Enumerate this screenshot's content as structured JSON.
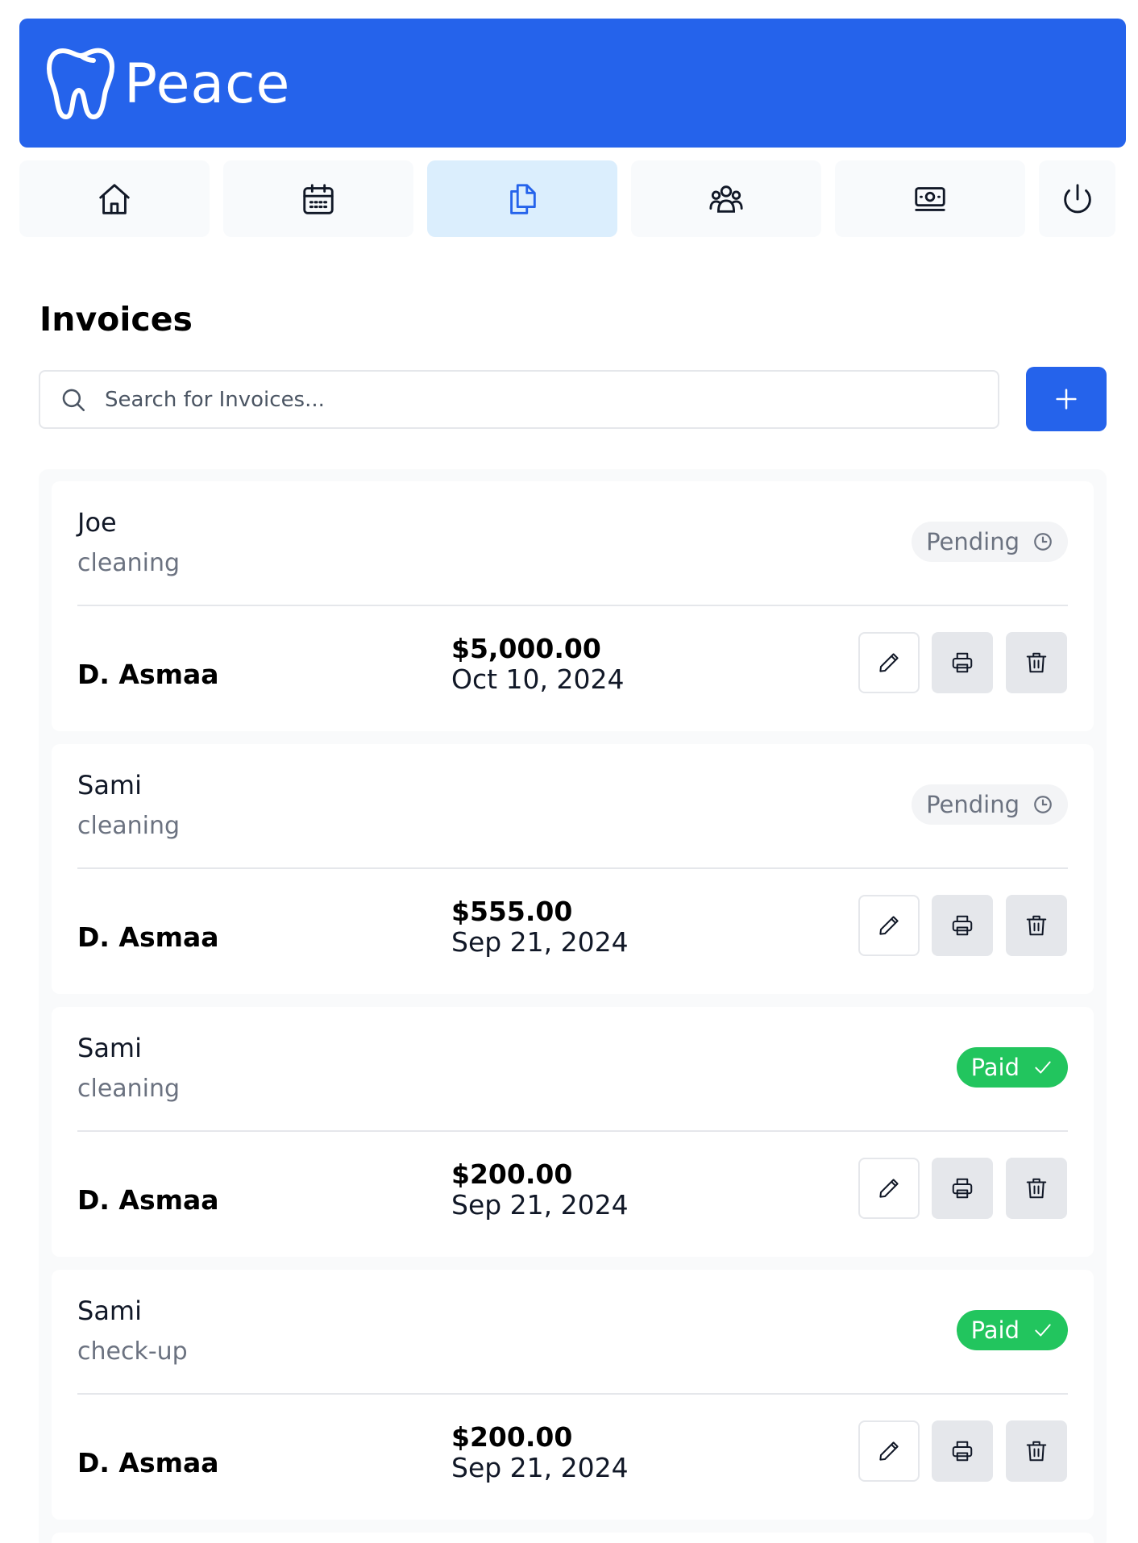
{
  "app": {
    "name": "Peace",
    "logo_icon": "tooth-icon",
    "brand_color": "#2563eb"
  },
  "nav": {
    "items": [
      {
        "icon": "home-icon"
      },
      {
        "icon": "calendar-icon"
      },
      {
        "icon": "documents-icon",
        "active": true
      },
      {
        "icon": "users-icon"
      },
      {
        "icon": "money-icon"
      },
      {
        "icon": "power-icon"
      }
    ]
  },
  "page": {
    "title": "Invoices"
  },
  "search": {
    "placeholder": "Search for Invoices..."
  },
  "invoices": [
    {
      "patient": "Joe",
      "service": "cleaning",
      "status": "Pending",
      "doctor": "D. Asmaa",
      "amount": "$5,000.00",
      "date": "Oct 10, 2024"
    },
    {
      "patient": "Sami",
      "service": "cleaning",
      "status": "Pending",
      "doctor": "D. Asmaa",
      "amount": "$555.00",
      "date": "Sep 21, 2024"
    },
    {
      "patient": "Sami",
      "service": "cleaning",
      "status": "Paid",
      "doctor": "D. Asmaa",
      "amount": "$200.00",
      "date": "Sep 21, 2024"
    },
    {
      "patient": "Sami",
      "service": "check-up",
      "status": "Paid",
      "doctor": "D. Asmaa",
      "amount": "$200.00",
      "date": "Sep 21, 2024"
    }
  ],
  "colors": {
    "paid": "#22c55e",
    "pending_bg": "#f3f4f6",
    "active_nav": "#dbeefd"
  }
}
